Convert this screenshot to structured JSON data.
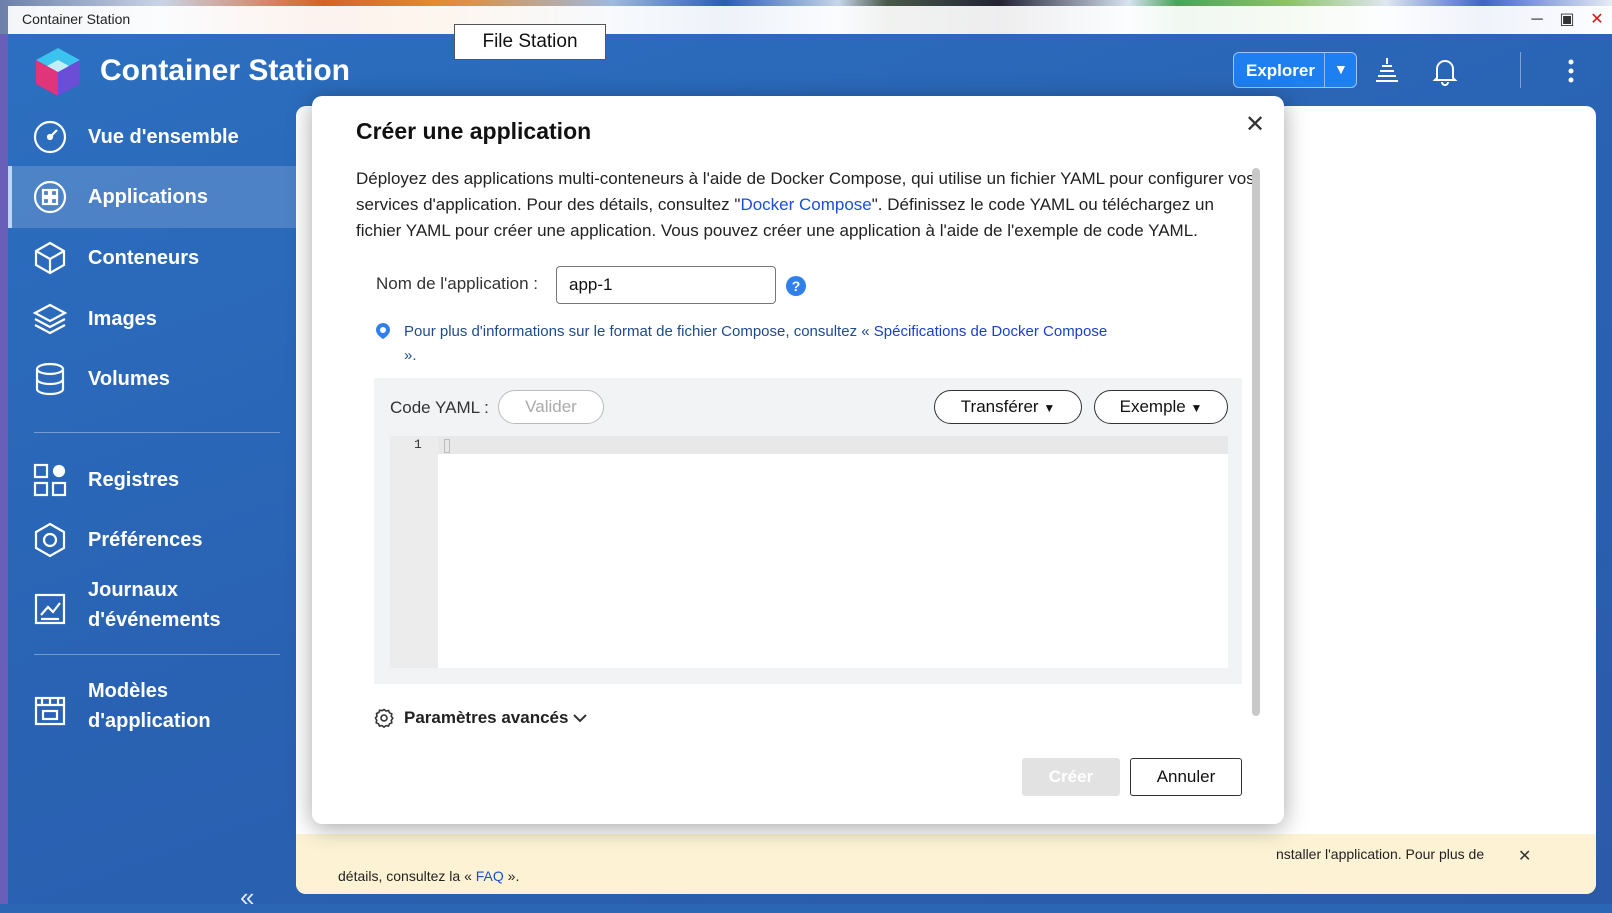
{
  "window": {
    "title": "Container Station",
    "controls": [
      "minimize-icon",
      "maximize-icon",
      "close-icon"
    ],
    "close_color": "#d11111"
  },
  "tooltip": {
    "text": "File Station"
  },
  "header": {
    "app_name": "Container Station",
    "explorer_label": "Explorer",
    "icons": [
      "logo-icon",
      "tasks-icon",
      "bell-icon",
      "more-icon"
    ]
  },
  "sidebar": {
    "items": [
      {
        "label": "Vue d'ensemble",
        "icon": "dashboard-icon",
        "active": false
      },
      {
        "label": "Applications",
        "icon": "applications-icon",
        "active": true
      },
      {
        "label": "Conteneurs",
        "icon": "container-icon",
        "active": false
      },
      {
        "label": "Images",
        "icon": "layers-icon",
        "active": false
      },
      {
        "label": "Volumes",
        "icon": "database-icon",
        "active": false
      },
      {
        "label": "Registres",
        "icon": "registry-icon",
        "active": false
      },
      {
        "label": "Préférences",
        "icon": "settings-icon",
        "active": false
      },
      {
        "label": "Journaux d'événements",
        "icon": "log-icon",
        "active": false
      },
      {
        "label": "Modèles d'application",
        "icon": "template-icon",
        "active": false
      }
    ]
  },
  "notice": {
    "text_line1": "nstaller l'application. Pour plus de",
    "text_line2_prefix": "détails, consultez la «",
    "link": "FAQ",
    "text_line2_suffix": "»."
  },
  "dialog": {
    "title": "Créer une application",
    "desc_part1": "Déployez des applications multi-conteneurs à l'aide de Docker Compose, qui utilise un fichier YAML pour configurer vos services d'application. Pour des détails, consultez \"",
    "desc_link": "Docker Compose",
    "desc_part2": "\". Définissez le code YAML ou téléchargez un fichier YAML pour créer une application. Vous pouvez créer une application à l'aide de l'exemple de code YAML.",
    "name_label": "Nom de l'application :",
    "name_value": "app-1",
    "info_prefix": "Pour plus d'informations sur le format de fichier Compose, consultez «",
    "info_link": "Spécifications de Docker Compose",
    "info_suffix": "».",
    "code_label": "Code YAML :",
    "validate_label": "Valider",
    "transfer_label": "Transférer",
    "example_label": "Exemple",
    "line_number": "1",
    "advanced_label": "Paramètres avancés",
    "create_label": "Créer",
    "cancel_label": "Annuler"
  },
  "colors": {
    "app_blue": "#2a63b4",
    "accent": "#1d7ff0",
    "link": "#1a4fd6",
    "notice_bg": "#fdf3d4"
  }
}
